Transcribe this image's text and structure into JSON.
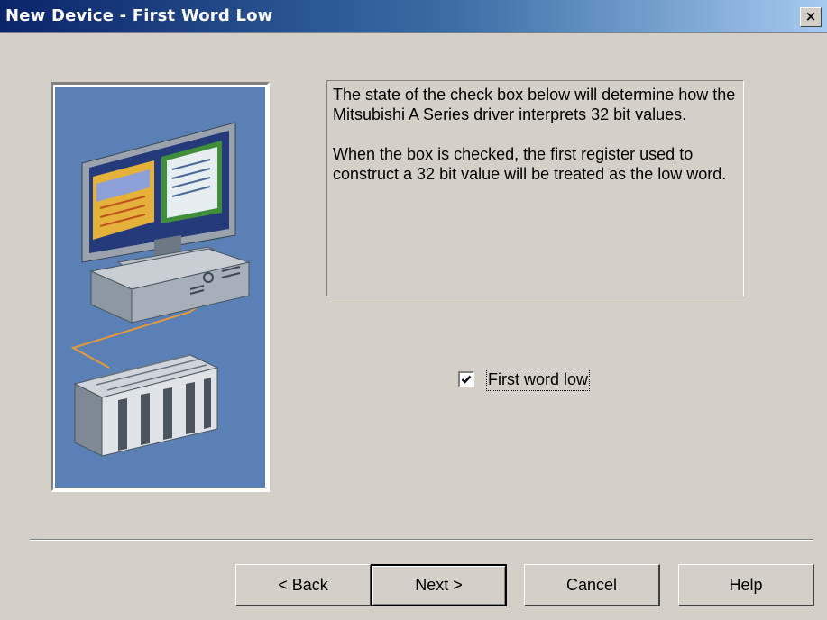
{
  "window": {
    "title": "New Device - First Word Low",
    "close_label": "×"
  },
  "description": {
    "paragraph1": "The state of the check box below will determine how the Mitsubishi A Series driver interprets 32 bit values.",
    "paragraph2": "When the box is checked, the first register used to construct a 32 bit value will be treated as the low word."
  },
  "checkbox": {
    "label": "First word low",
    "checked": true
  },
  "buttons": {
    "back": "< Back",
    "next": "Next >",
    "cancel": "Cancel",
    "help": "Help"
  },
  "colors": {
    "title_gradient_start": "#0a246a",
    "title_gradient_end": "#a6caf0",
    "dialog_background": "#d4d0c8",
    "illustration_background": "#5a80b5"
  }
}
